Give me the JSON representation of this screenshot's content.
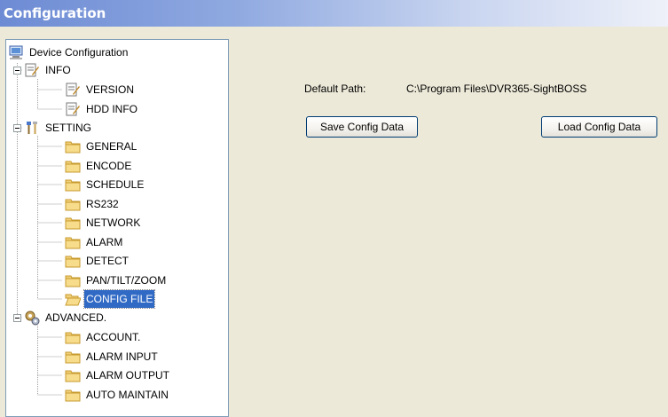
{
  "window": {
    "title": "Configuration"
  },
  "tree": {
    "root": {
      "label": "Device Configuration",
      "icon": "computer-icon"
    },
    "nodes": [
      {
        "label": "INFO",
        "icon": "info-document-icon"
      },
      {
        "label": "VERSION",
        "icon": "document-edit-icon"
      },
      {
        "label": "HDD INFO",
        "icon": "document-edit-icon"
      },
      {
        "label": "SETTING",
        "icon": "tools-icon"
      },
      {
        "label": "GENERAL",
        "icon": "folder-icon"
      },
      {
        "label": "ENCODE",
        "icon": "folder-icon"
      },
      {
        "label": "SCHEDULE",
        "icon": "folder-icon"
      },
      {
        "label": "RS232",
        "icon": "folder-icon"
      },
      {
        "label": "NETWORK",
        "icon": "folder-icon"
      },
      {
        "label": "ALARM",
        "icon": "folder-icon"
      },
      {
        "label": "DETECT",
        "icon": "folder-icon"
      },
      {
        "label": "PAN/TILT/ZOOM",
        "icon": "folder-icon"
      },
      {
        "label": "CONFIG FILE",
        "icon": "folder-open-icon",
        "selected": true
      },
      {
        "label": "ADVANCED.",
        "icon": "gears-icon"
      },
      {
        "label": "ACCOUNT.",
        "icon": "folder-icon"
      },
      {
        "label": "ALARM INPUT",
        "icon": "folder-icon"
      },
      {
        "label": "ALARM OUTPUT",
        "icon": "folder-icon"
      },
      {
        "label": "AUTO MAINTAIN",
        "icon": "folder-icon"
      }
    ]
  },
  "config_file": {
    "default_path_label": "Default Path:",
    "default_path_value": "C:\\Program Files\\DVR365-SightBOSS",
    "save_button": "Save Config Data",
    "load_button": "Load Config Data"
  },
  "colors": {
    "selection": "#316ac5",
    "titlebar": "#6d8bd4"
  }
}
